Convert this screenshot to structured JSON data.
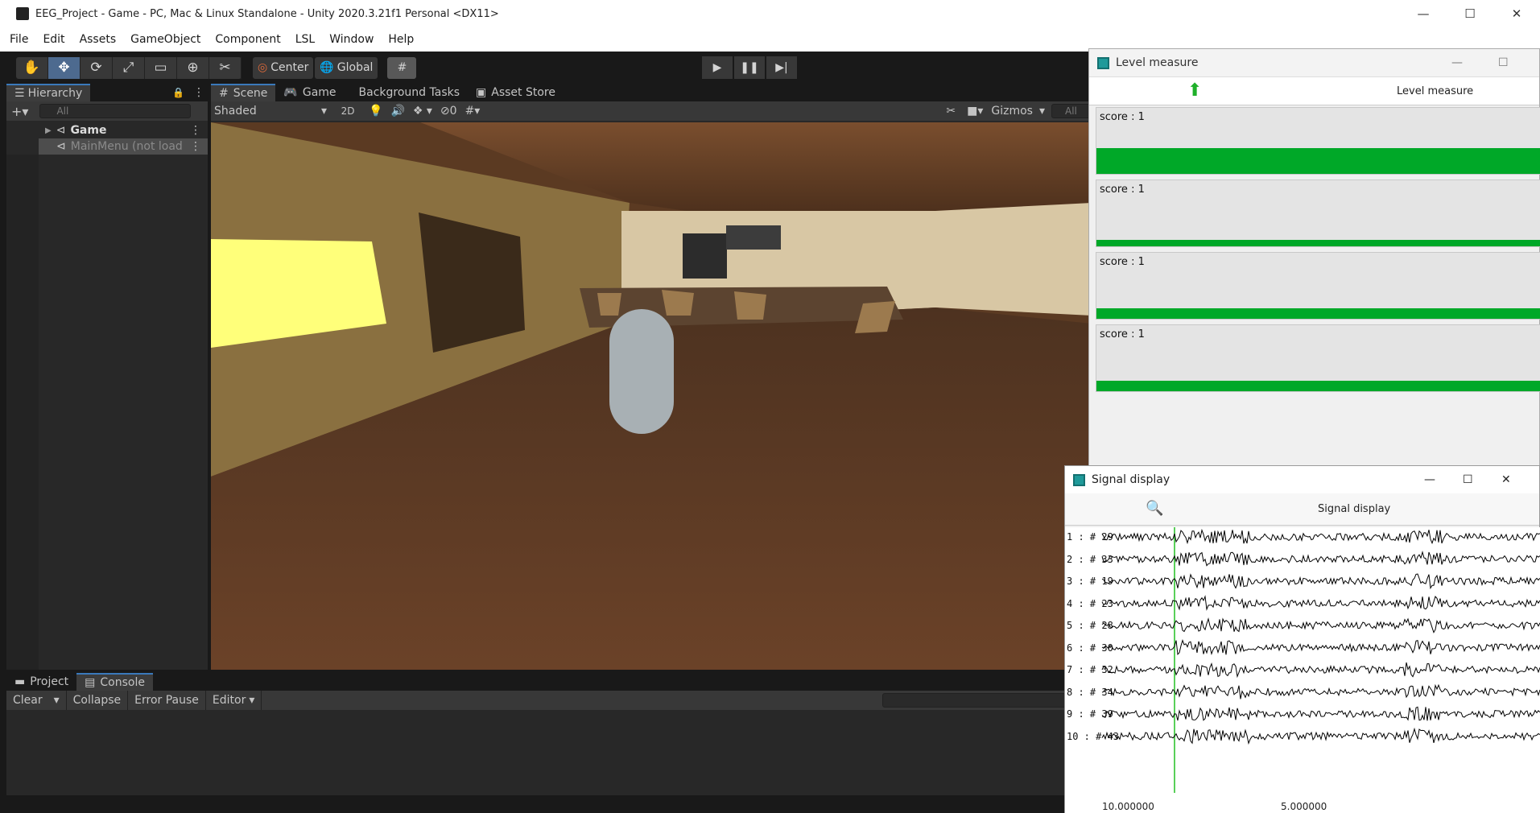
{
  "window": {
    "title": "EEG_Project - Game - PC, Mac & Linux Standalone - Unity 2020.3.21f1 Personal <DX11>"
  },
  "menu": [
    "File",
    "Edit",
    "Assets",
    "GameObject",
    "Component",
    "LSL",
    "Window",
    "Help"
  ],
  "toolbar": {
    "center": "Center",
    "global": "Global"
  },
  "hierarchy": {
    "tab": "Hierarchy",
    "search_placeholder": "All",
    "items": [
      {
        "label": "Game",
        "bold": true
      },
      {
        "label": "MainMenu (not load",
        "bold": false
      }
    ]
  },
  "scene": {
    "tabs": [
      "Scene",
      "Game",
      "Background Tasks",
      "Asset Store"
    ],
    "shading": "Shaded",
    "mode2d": "2D",
    "hidden_count": "0",
    "gizmos": "Gizmos",
    "search_placeholder": "All"
  },
  "bottom": {
    "tabs": [
      "Project",
      "Console"
    ],
    "buttons": [
      "Clear",
      "Collapse",
      "Error Pause",
      "Editor"
    ]
  },
  "level_measure": {
    "title": "Level measure",
    "header": "Level measure",
    "scores": [
      {
        "label": "score : 1",
        "fill": 0.38
      },
      {
        "label": "score : 1",
        "fill": 0.1
      },
      {
        "label": "score : 1",
        "fill": 0.15
      },
      {
        "label": "score : 1",
        "fill": 0.15
      }
    ],
    "bar_color": "#00a828"
  },
  "signal_display": {
    "title": "Signal display",
    "header": "Signal display",
    "channels": [
      "1 : # 29",
      "2 : # 33",
      "3 : # 19",
      "4 : # 23",
      "5 : # 28",
      "6 : # 30",
      "7 : # 32",
      "8 : # 34",
      "9 : # 39",
      "10 : # 43"
    ],
    "axis_labels": [
      "10.000000",
      "5.000000"
    ]
  }
}
